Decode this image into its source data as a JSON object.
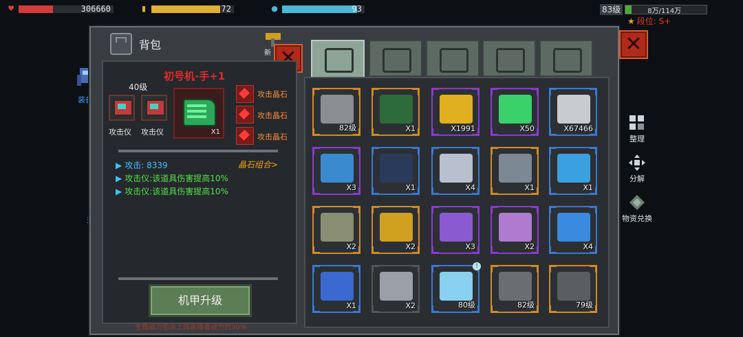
{
  "hud": {
    "hp_value": "306660",
    "energy_value": "72",
    "water_value": "93",
    "hp_fraction": 0.36,
    "energy_fraction": 0.83,
    "water_fraction": 0.91,
    "level_label": "83级",
    "exp_text": "8万/114万",
    "exp_fraction": 0.07,
    "rank_text": "段位: S+"
  },
  "side": {
    "equip_label": "装备",
    "upgrade_label": "升"
  },
  "bag": {
    "title": "背包",
    "partial_label": "新",
    "close_glyph": "✕"
  },
  "detail": {
    "item_name": "初号机-手+1",
    "level": "40级",
    "slots": [
      {
        "label": "攻击仪"
      },
      {
        "label": "攻击仪"
      }
    ],
    "main_item_count": "X1",
    "gems": [
      {
        "label": "攻击晶石"
      },
      {
        "label": "攻击晶石"
      },
      {
        "label": "攻击晶石"
      }
    ],
    "stats": [
      {
        "text": "攻击: 8339",
        "color": "#3ec0ff"
      },
      {
        "text": "攻击仪:该道具伤害提高10%",
        "color": "#54e04a"
      },
      {
        "text": "攻击仪:该道具伤害提高10%",
        "color": "#54e04a"
      }
    ],
    "combo_link": "晶石组合>",
    "upgrade_button": "机甲升级",
    "footer_note": "主角战力包含上阵返魂者战力的30%"
  },
  "tabs": [
    {
      "name": "backpack",
      "icon": "backpack-icon",
      "active": true
    },
    {
      "name": "medkit",
      "icon": "medkit-icon",
      "active": false
    },
    {
      "name": "food",
      "icon": "food-icon",
      "active": false
    },
    {
      "name": "weapon",
      "icon": "gun-icon",
      "active": false
    },
    {
      "name": "tools",
      "icon": "tools-icon",
      "active": false
    }
  ],
  "items": [
    {
      "icon": "axe-icon",
      "qty": "82级",
      "rarity": "#d08a2a",
      "art": "#8a8e92"
    },
    {
      "icon": "sale-coupon-icon",
      "qty": "X1",
      "rarity": "#d08a2a",
      "art": "#2e6b3a"
    },
    {
      "icon": "gold-coin-icon",
      "qty": "X1991",
      "rarity": "#8a3ad0",
      "art": "#e0b020"
    },
    {
      "icon": "cocktail-icon",
      "qty": "X50",
      "rarity": "#8a3ad0",
      "art": "#3ad06a"
    },
    {
      "icon": "silver-coin-icon",
      "qty": "X67466",
      "rarity": "#3a7ad0",
      "art": "#c8ccd0"
    },
    {
      "icon": "tool-book-icon",
      "qty": "X3",
      "rarity": "#8a3ad0",
      "art": "#3a8ad0"
    },
    {
      "icon": "exp-card-icon",
      "qty": "X1",
      "rarity": "#3a7ad0",
      "art": "#2a3a5a"
    },
    {
      "icon": "map-icon",
      "qty": "X4",
      "rarity": "#3a7ad0",
      "art": "#b8c0d0"
    },
    {
      "icon": "exp-badge-icon",
      "qty": "X1",
      "rarity": "#d08a2a",
      "art": "#7c8894"
    },
    {
      "icon": "music-icon",
      "qty": "X1",
      "rarity": "#3a7ad0",
      "art": "#3aa0e0"
    },
    {
      "icon": "chest-icon",
      "qty": "X2",
      "rarity": "#d08a2a",
      "art": "#8a8e72"
    },
    {
      "icon": "gold-chest-icon",
      "qty": "X2",
      "rarity": "#d08a2a",
      "art": "#d0a020"
    },
    {
      "icon": "purple-chest-icon",
      "qty": "X3",
      "rarity": "#8a3ad0",
      "art": "#8a5ad0"
    },
    {
      "icon": "purple-gold-chest-icon",
      "qty": "X2",
      "rarity": "#8a3ad0",
      "art": "#b07ad0"
    },
    {
      "icon": "blue-chest-icon",
      "qty": "X4",
      "rarity": "#3a7ad0",
      "art": "#3a8ae0"
    },
    {
      "icon": "blue-cage-icon",
      "qty": "X1",
      "rarity": "#3a7ad0",
      "art": "#3a6ad0"
    },
    {
      "icon": "grey-crate-icon",
      "qty": "X2",
      "rarity": "#555555",
      "art": "#9aa0a6"
    },
    {
      "icon": "lightning-blade-icon",
      "qty": "80级",
      "rarity": "#3a7ad0",
      "art": "#8ad0f0",
      "badge": "!"
    },
    {
      "icon": "assault-rifle-icon",
      "qty": "82级",
      "rarity": "#d08a2a",
      "art": "#6a6e72"
    },
    {
      "icon": "crossbow-icon",
      "qty": "79级",
      "rarity": "#d08a2a",
      "art": "#5a5e62"
    }
  ],
  "right_buttons": {
    "sort_label": "整理",
    "decompose_label": "分解",
    "exchange_label": "物资兑换"
  },
  "colors": {
    "hp": "#d63a3a",
    "energy": "#e0b030",
    "water": "#49b8d6"
  }
}
